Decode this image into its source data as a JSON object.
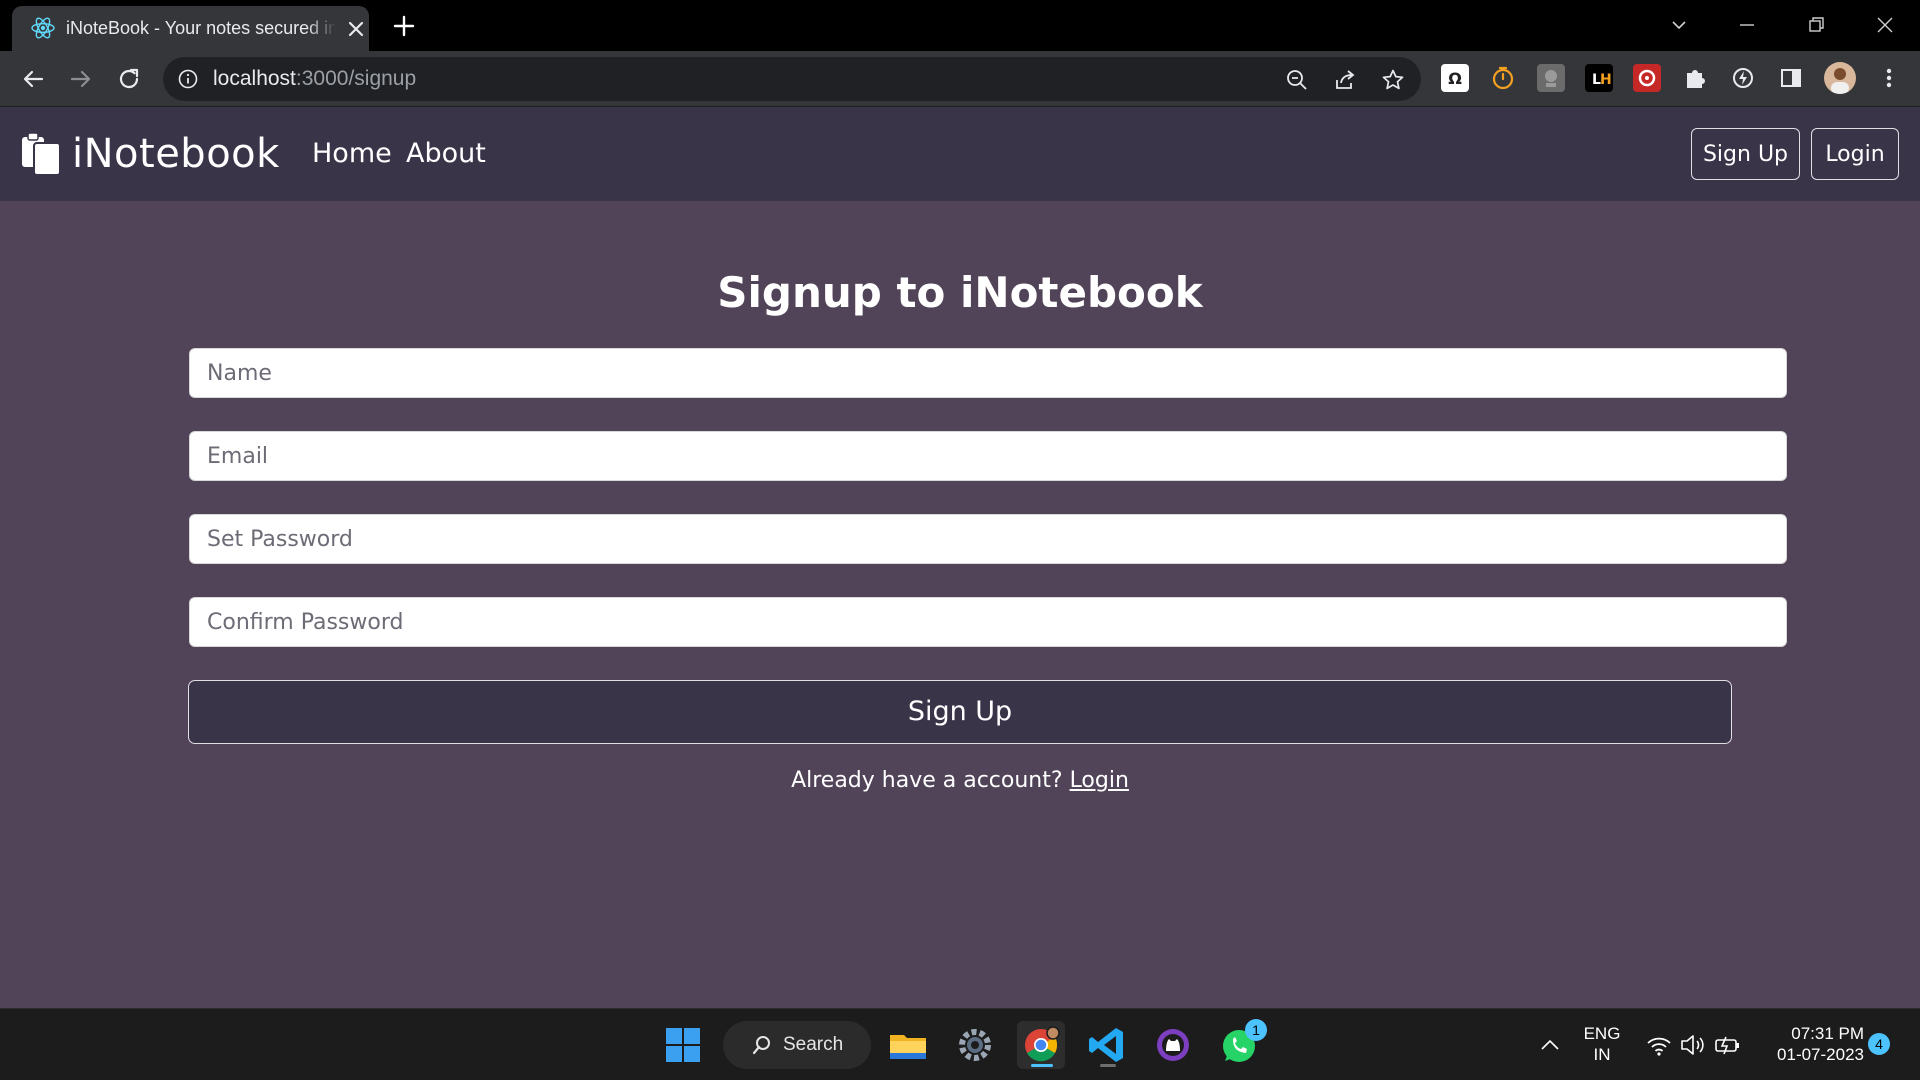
{
  "browser": {
    "tab_title": "iNoteBook - Your notes secured in the cloud",
    "url_host": "localhost",
    "url_path": ":3000/signup"
  },
  "navbar": {
    "brand": "iNotebook",
    "links": [
      "Home",
      "About"
    ],
    "signup_button": "Sign Up",
    "login_button": "Login"
  },
  "form": {
    "title": "Signup to iNotebook",
    "name_placeholder": "Name",
    "email_placeholder": "Email",
    "password_placeholder": "Set Password",
    "confirm_placeholder": "Confirm Password",
    "submit_label": "Sign Up",
    "already_text": "Already have a account?",
    "login_link": "Login"
  },
  "taskbar": {
    "search_label": "Search",
    "lang": "ENG",
    "region": "IN",
    "time": "07:31 PM",
    "date": "01-07-2023",
    "notification_count": "4",
    "whatsapp_badge": "1"
  },
  "colors": {
    "page_background": "#514459",
    "navbar_background": "#3a3449",
    "submit_background": "#3a3449"
  }
}
